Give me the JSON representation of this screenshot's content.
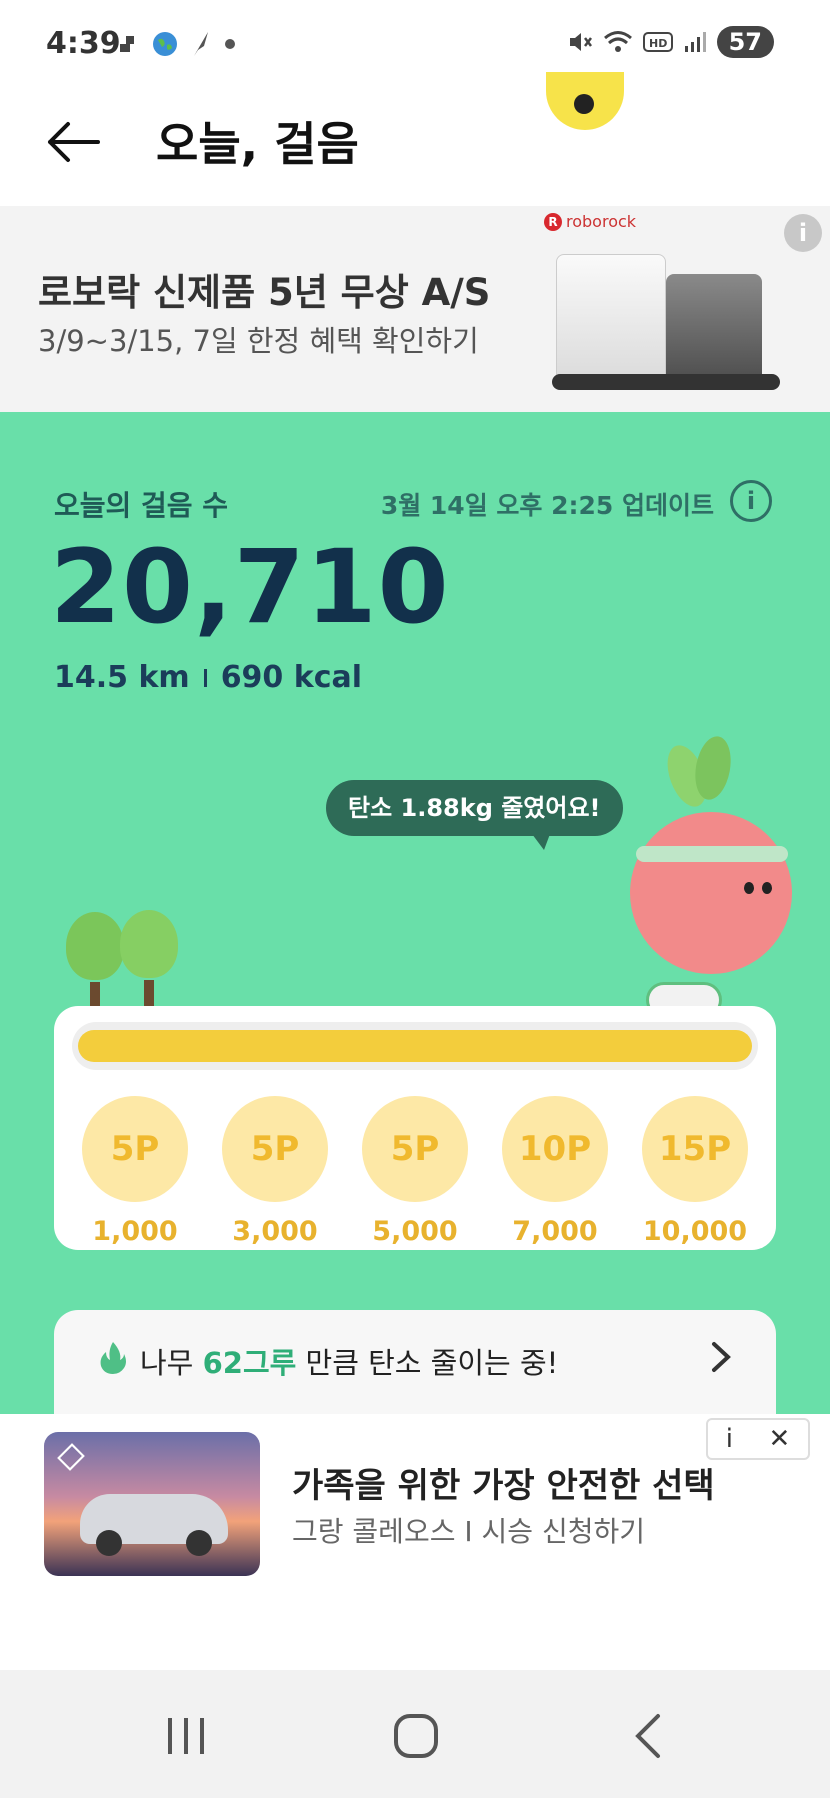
{
  "status_bar": {
    "time": "4:39",
    "battery": "57",
    "icons_left": [
      "notification-icon",
      "globe-icon",
      "feather-icon",
      "dot-icon"
    ],
    "icons_right": [
      "mute-icon",
      "wifi-icon",
      "hd-icon",
      "signal-icon"
    ]
  },
  "header": {
    "title": "오늘, 걸음",
    "back_icon": "arrow-left-icon"
  },
  "top_ad": {
    "brand": "roborock",
    "title": "로보락 신제품 5년 무상 A/S",
    "subtitle": "3/9~3/15, 7일 한정 혜택 확인하기",
    "info": "i"
  },
  "steps": {
    "label": "오늘의 걸음 수",
    "updated": "3월 14일 오후 2:25 업데이트",
    "info": "i",
    "count": "20,710",
    "distance": "14.5 km",
    "calories": "690 kcal",
    "carbon_bubble": "탄소 1.88kg 줄였어요!"
  },
  "progress": {
    "fraction": 1.0,
    "milestones": [
      {
        "points": "5P",
        "threshold": "1,000"
      },
      {
        "points": "5P",
        "threshold": "3,000"
      },
      {
        "points": "5P",
        "threshold": "5,000"
      },
      {
        "points": "10P",
        "threshold": "7,000"
      },
      {
        "points": "15P",
        "threshold": "10,000"
      }
    ]
  },
  "carbon_row": {
    "prefix": "나무 ",
    "highlight": "62그루",
    "suffix": " 만큼 탄소 줄이는 중!"
  },
  "bottom_ad": {
    "title": "가족을 위한 가장 안전한 선택",
    "subtitle": "그랑 콜레오스 I 시승 신청하기",
    "info": "i",
    "close": "✕"
  },
  "colors": {
    "green_bg": "#69dfa9",
    "accent_yellow": "#f3cd3c",
    "coin": "#fde8a6",
    "navy": "#12304b",
    "highlight_green": "#2fae78"
  }
}
